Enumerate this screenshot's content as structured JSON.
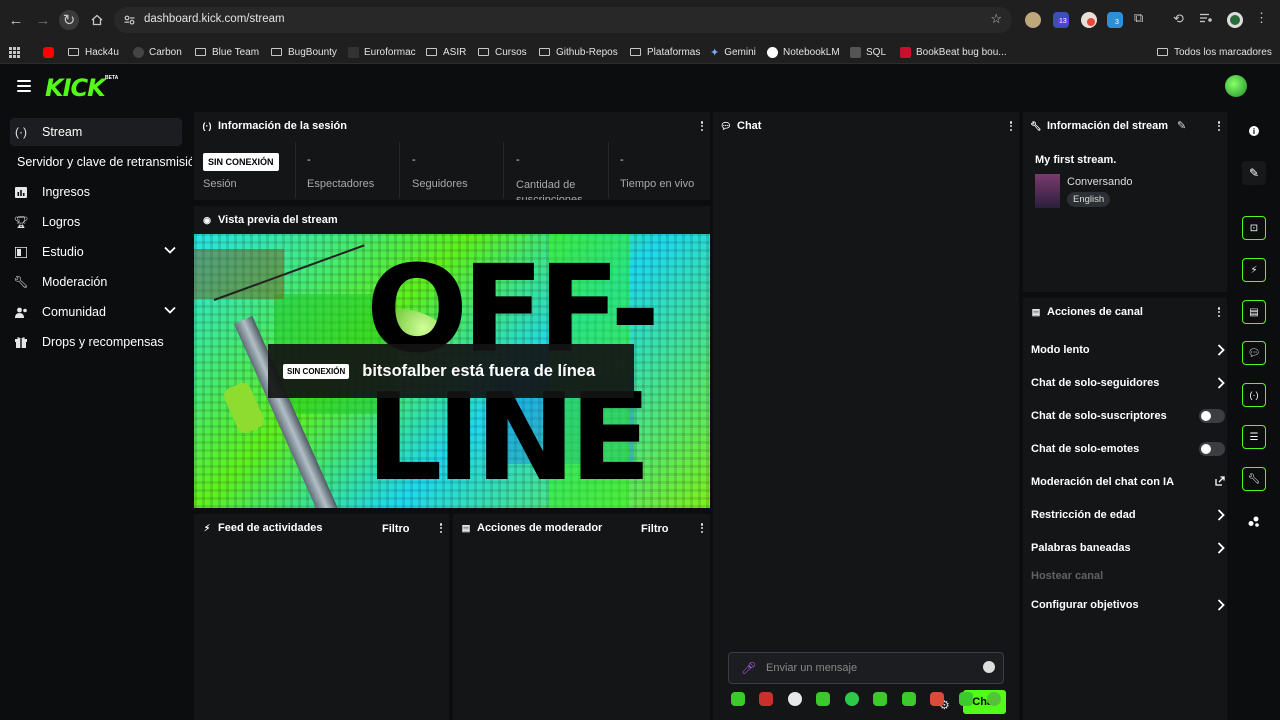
{
  "browser": {
    "url": "dashboard.kick.com/stream",
    "ext_badges": [
      "13",
      "3"
    ],
    "bookmarks": [
      "Hack4u",
      "Carbon",
      "Blue Team",
      "BugBounty",
      "Euroformac",
      "ASIR",
      "Cursos",
      "Github-Repos",
      "Plataformas",
      "Gemini",
      "NotebookLM",
      "SQL",
      "BookBeat bug bou...",
      "Todos los marcadores"
    ]
  },
  "header": {
    "logo": "KICK",
    "beta": "BETA"
  },
  "sidebar": {
    "items": [
      {
        "label": "Stream",
        "icon": "broadcast-icon"
      },
      {
        "label": "Servidor y clave de retransmisión"
      },
      {
        "label": "Ingresos",
        "icon": "chart-icon"
      },
      {
        "label": "Logros",
        "icon": "trophy-icon"
      },
      {
        "label": "Estudio",
        "icon": "studio-icon"
      },
      {
        "label": "Moderación",
        "icon": "wrench-icon"
      },
      {
        "label": "Comunidad",
        "icon": "users-icon"
      },
      {
        "label": "Drops y recompensas",
        "icon": "gift-icon"
      }
    ]
  },
  "session": {
    "title": "Información de la sesión",
    "status_badge": "SIN CONEXIÓN",
    "session_label": "Sesión",
    "stats": [
      {
        "value": "-",
        "label": "Espectadores"
      },
      {
        "value": "-",
        "label": "Seguidores"
      },
      {
        "value": "-",
        "label": "Cantidad de suscripciones"
      },
      {
        "value": "-",
        "label": "Tiempo en vivo"
      }
    ]
  },
  "preview": {
    "title": "Vista previa del stream",
    "offline_badge": "SIN CONEXIÓN",
    "offline_text": "bitsofalber está fuera de línea",
    "bg_text_1": "OFF-",
    "bg_text_2": "LINE"
  },
  "feed": {
    "title": "Feed de actividades",
    "filter": "Filtro"
  },
  "modactions": {
    "title": "Acciones de moderador",
    "filter": "Filtro"
  },
  "chat": {
    "title": "Chat",
    "placeholder": "Enviar un mensaje",
    "send": "Chat"
  },
  "stream_info": {
    "title": "Información del stream",
    "stream_title": "My first stream.",
    "category": "Conversando",
    "language": "English"
  },
  "channel_actions": {
    "title": "Acciones de canal",
    "items": [
      {
        "label": "Modo lento",
        "type": "arrow"
      },
      {
        "label": "Chat de solo-seguidores",
        "type": "arrow"
      },
      {
        "label": "Chat de solo-suscriptores",
        "type": "toggle"
      },
      {
        "label": "Chat de solo-emotes",
        "type": "toggle"
      },
      {
        "label": "Moderación del chat con IA",
        "type": "external"
      },
      {
        "label": "Restricción de edad",
        "type": "arrow"
      },
      {
        "label": "Palabras baneadas",
        "type": "arrow"
      },
      {
        "label": "Hostear canal",
        "type": "disabled"
      },
      {
        "label": "Configurar objetivos",
        "type": "arrow"
      }
    ]
  },
  "colors": {
    "accent": "#53fc18",
    "panel": "#141517",
    "bg": "#0b0d0e"
  }
}
